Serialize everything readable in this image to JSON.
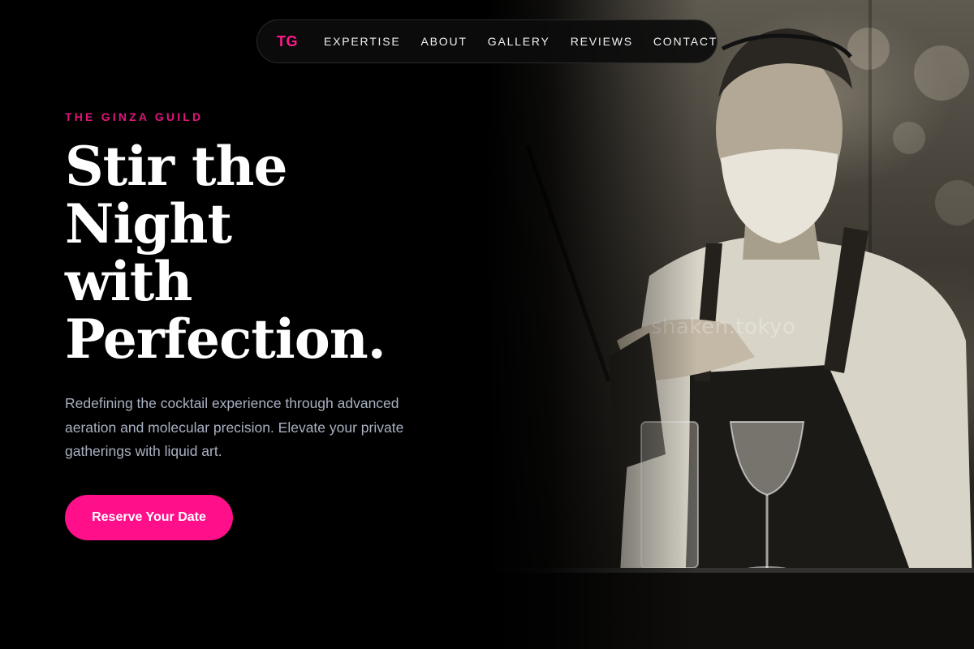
{
  "nav": {
    "logo": "TG",
    "links": [
      "EXPERTISE",
      "ABOUT",
      "GALLERY",
      "REVIEWS",
      "CONTACT"
    ]
  },
  "hero": {
    "eyebrow": "THE GINZA GUILD",
    "headline_lines": [
      "Stir the",
      "Night",
      "with",
      "Perfection."
    ],
    "subtext": "Redefining the cocktail experience through advanced aeration and molecular precision. Elevate your private gatherings with liquid art.",
    "cta_label": "Reserve Your Date",
    "image_watermark": "shaken.tokyo"
  },
  "colors": {
    "accent": "#ff0f8a",
    "eyebrow": "#e0167c",
    "background": "#000000",
    "subtext": "#a9b1c2"
  }
}
